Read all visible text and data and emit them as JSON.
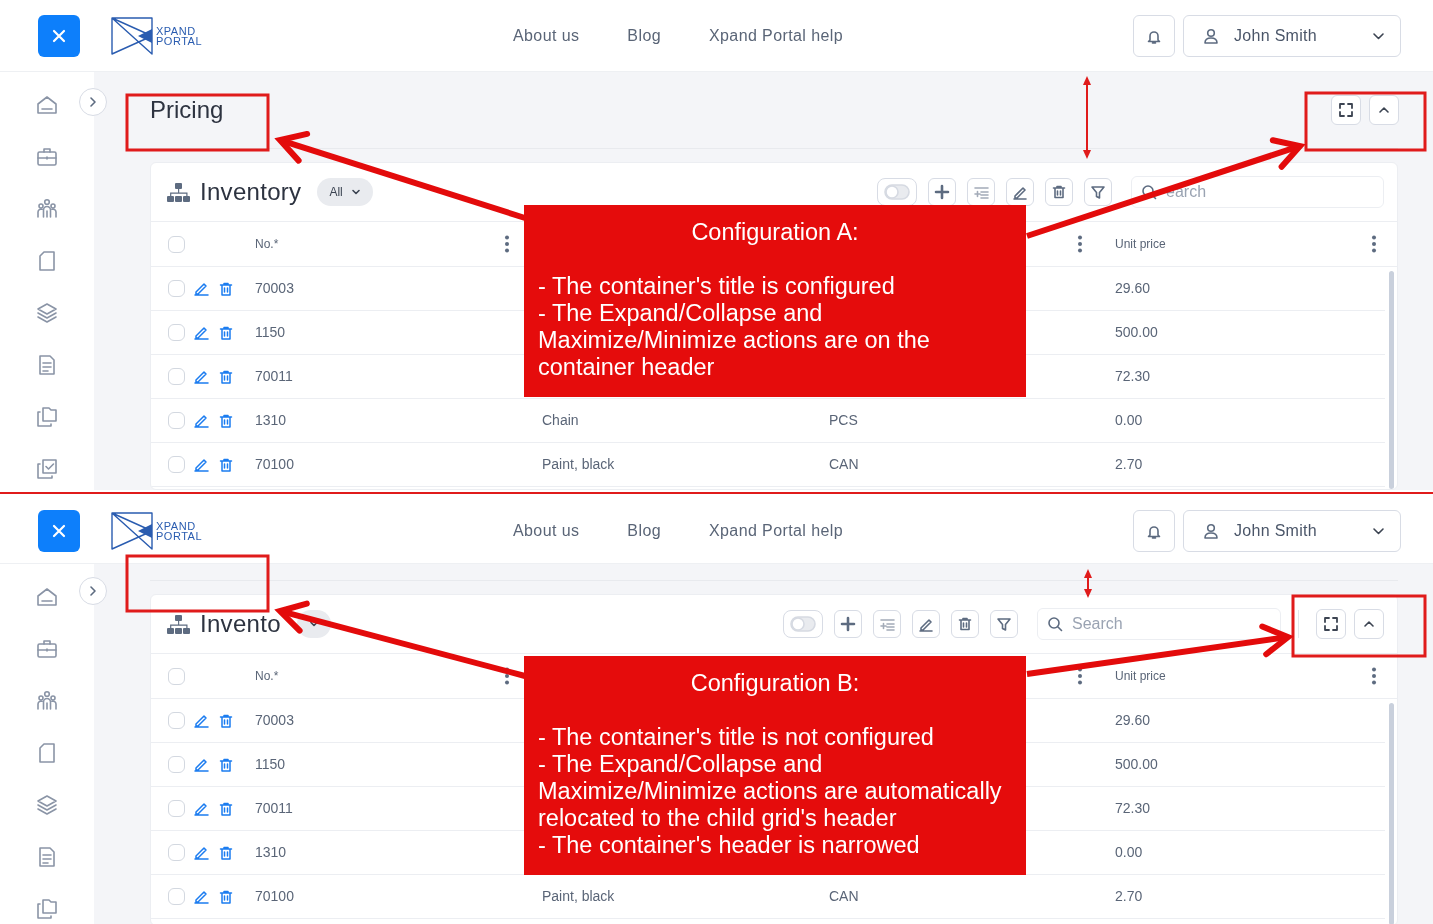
{
  "panels": [
    {
      "kind": "container",
      "header": {
        "logo": {
          "line_1": "XPAND",
          "line_2": "PORTAL"
        },
        "nav": [
          "About us",
          "Blog",
          "Xpand Portal help"
        ],
        "user": "John Smith"
      },
      "container_title": "Pricing",
      "grid": {
        "title": "Inventory",
        "filter": "All",
        "toggle": {
          "on": false
        },
        "search": {
          "placeholder": "earch"
        },
        "header": {
          "no": "No.*",
          "unit_price": "Unit price"
        },
        "select_all": false,
        "rows": [
          {
            "no": "70003",
            "unit_price": "29.60",
            "checked": false
          },
          {
            "no": "1150",
            "unit_price": "500.00",
            "checked": false
          },
          {
            "no": "70011",
            "unit_price": "72.30",
            "checked": false
          },
          {
            "no": "1310",
            "column_2": "Chain",
            "column_3": "PCS",
            "unit_price": "0.00",
            "checked": false
          },
          {
            "no": "70100",
            "column_2": "Paint, black",
            "column_3": "CAN",
            "unit_price": "2.70",
            "checked": false
          }
        ]
      },
      "callout": {
        "title": "Configuration A:",
        "points": [
          "- The container's title is configured",
          "- The Expand/Collapse and Maximize/Minimize actions are on the container header"
        ]
      }
    },
    {
      "kind": "grid",
      "header": {
        "logo": {
          "line_1": "XPAND",
          "line_2": "PORTAL"
        },
        "nav": [
          "About us",
          "Blog",
          "Xpand Portal help"
        ],
        "user": "John Smith"
      },
      "grid": {
        "title": "Invento",
        "toggle": {
          "on": false
        },
        "search": {
          "placeholder": "Search"
        },
        "header": {
          "no": "No.*",
          "unit_price": "Unit price"
        },
        "select_all": false,
        "rows": [
          {
            "no": "70003",
            "unit_price": "29.60",
            "checked": false
          },
          {
            "no": "1150",
            "unit_price": "500.00",
            "checked": false
          },
          {
            "no": "70011",
            "unit_price": "72.30",
            "checked": false
          },
          {
            "no": "1310",
            "unit_price": "0.00",
            "checked": false
          },
          {
            "no": "70100",
            "column_2": "Paint, black",
            "column_3": "CAN",
            "unit_price": "2.70",
            "checked": false
          }
        ]
      },
      "callout": {
        "title": "Configuration B:",
        "points": [
          "- The container's title is not configured",
          "- The Expand/Collapse and Maximize/Minimize actions are automatically relocated to the child grid's header",
          "- The container's header is narrowed"
        ]
      }
    }
  ]
}
